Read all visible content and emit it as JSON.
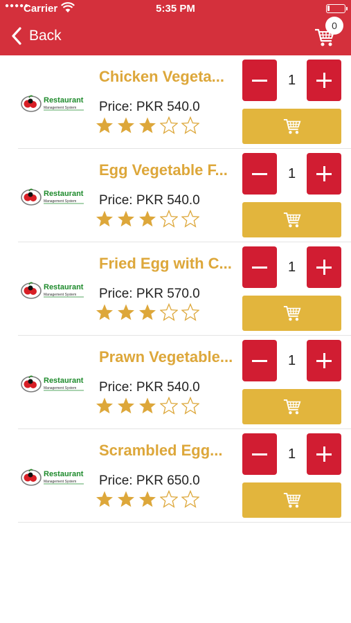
{
  "status_bar": {
    "carrier": "Carrier",
    "time": "5:35 PM"
  },
  "nav": {
    "back_label": "Back",
    "cart_count": "0"
  },
  "colors": {
    "header": "#D4303C",
    "title": "#DDA73A",
    "quantity_button": "#D11D32",
    "add_to_cart": "#E2B53D",
    "star": "#DDA73A"
  },
  "icons": {
    "back": "chevron-left-icon",
    "cart": "cart-icon",
    "star_filled": "star-filled-icon",
    "star_empty": "star-outline-icon",
    "minus": "minus-icon",
    "plus": "plus-icon"
  },
  "products": [
    {
      "name": "Chicken Vegeta...",
      "price": "Price: PKR 540.0",
      "rating": 3,
      "max_rating": 5,
      "quantity": "1",
      "logo_text": "Restaurant",
      "logo_subtext": "Management System"
    },
    {
      "name": "Egg Vegetable F...",
      "price": "Price: PKR 540.0",
      "rating": 3,
      "max_rating": 5,
      "quantity": "1",
      "logo_text": "Restaurant",
      "logo_subtext": "Management System"
    },
    {
      "name": "Fried Egg with C...",
      "price": "Price: PKR 570.0",
      "rating": 3,
      "max_rating": 5,
      "quantity": "1",
      "logo_text": "Restaurant",
      "logo_subtext": "Management System"
    },
    {
      "name": "Prawn Vegetable...",
      "price": "Price: PKR 540.0",
      "rating": 3,
      "max_rating": 5,
      "quantity": "1",
      "logo_text": "Restaurant",
      "logo_subtext": "Management System"
    },
    {
      "name": "Scrambled Egg...",
      "price": "Price: PKR 650.0",
      "rating": 3,
      "max_rating": 5,
      "quantity": "1",
      "logo_text": "Restaurant",
      "logo_subtext": "Management System"
    }
  ]
}
